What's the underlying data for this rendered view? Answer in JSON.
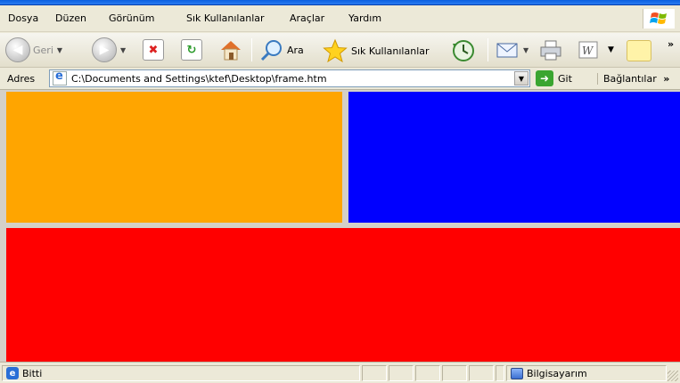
{
  "menu": {
    "items": [
      "Dosya",
      "Düzen",
      "Görünüm",
      "Sık Kullanılanlar",
      "Araçlar",
      "Yardım"
    ]
  },
  "toolbar": {
    "back_label": "Geri",
    "search_label": "Ara",
    "favorites_label": "Sık Kullanılanlar",
    "overflow": "»"
  },
  "address": {
    "label": "Adres",
    "url": "C:\\Documents and Settings\\ktef\\Desktop\\frame.htm",
    "go_label": "Git",
    "links_label": "Bağlantılar"
  },
  "frames": {
    "top_left_color": "#ffa500",
    "top_right_color": "#0000ff",
    "bottom_color": "#ff0000"
  },
  "status": {
    "text": "Bitti",
    "zone": "Bilgisayarım"
  }
}
